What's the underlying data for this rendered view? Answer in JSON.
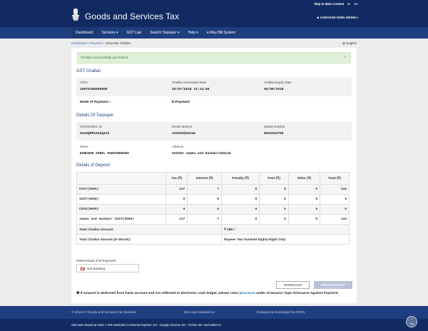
{
  "header": {
    "skip_link": "Skip to Main Content",
    "font_minus": "A-",
    "font_plus": "A+",
    "brand": "Goods and Services Tax",
    "user": "KANCHAN SUNIL MANSI"
  },
  "nav": [
    "Dashboard",
    "Services ▾",
    "GST Law",
    "Search Taxpayer ▾",
    "Help ▾",
    "e-Way Bill System"
  ],
  "breadcrumb": [
    "Dashboard",
    "Payment",
    "Generate Challan"
  ],
  "language": "English",
  "alert": "Challan successfully generated",
  "gst_challan": {
    "title": "GST Challan",
    "cpin_label": "CPIN",
    "cpin": "18070100000006",
    "gen_date_label": "Challan Generation Date",
    "gen_date": "20/07/2018 12:14:58",
    "exp_date_label": "Challan Expiry Date",
    "exp_date": "04/08/2018",
    "mode_label": "Mode of Payment :-",
    "mode": "E-Payment"
  },
  "taxpayer": {
    "title": "Details Of Taxpayer",
    "gstin_label": "GSTIN/Other Id",
    "gstin": "01AAQPM1032Q1CX",
    "email_label": "Email Address",
    "email": "vXXXXX@XXXom",
    "mobile_label": "Mobile Number",
    "mobile": "8XXXXX4750",
    "name_label": "Name",
    "name": "KANCHAN SUNIL MANSINGHANI",
    "address_label": "Address",
    "address": "XXXXXX Jammu and Kashmir184144"
  },
  "deposit": {
    "title": "Details of Deposit",
    "headers": [
      "",
      "Tax (₹)",
      "Interest (₹)",
      "Penalty (₹)",
      "Fees (₹)",
      "Other (₹)",
      "Total (₹)"
    ],
    "rows": [
      [
        "CGST(0005)",
        "137",
        "7",
        "0",
        "0",
        "0",
        "144"
      ],
      [
        "IGST(0008)",
        "0",
        "0",
        "0",
        "0",
        "0",
        "0"
      ],
      [
        "CESS(0009)",
        "0",
        "0",
        "0",
        "0",
        "0",
        "0"
      ],
      [
        "Jammu and Kashmir SGST(0006)",
        "137",
        "7",
        "0",
        "0",
        "0",
        "144"
      ]
    ],
    "total_label": "Total Challan Amount:",
    "total_value": "₹ 288 /-",
    "words_label": "Total Challan Amount (In Words):",
    "words_value": "Rupees Two hundred Eighty-Eight Only"
  },
  "payment_mode": {
    "label": "Select Mode of E-Payment",
    "required": "*",
    "selected": "Net Banking"
  },
  "buttons": {
    "download": "DOWNLOAD",
    "make_payment": "MAKE PAYMENT"
  },
  "note": {
    "part1": "If amount is deducted from bank account and not reflected in electronic cash ledger, please raise ",
    "link": "grievance",
    "part2": " under Grievance Type Grievance Against Payment."
  },
  "footer": {
    "copyright": "© 2016-17 Goods and Services Tax Network",
    "updated": "Site Last Updated on",
    "designed": "Designed & Developed by GSTN",
    "browser_note": "Site best viewed at 1024 x 768 resolution in Internet Explorer 10+, Google Chrome 49+, Firefox 45+ and Safari 6+",
    "top": "Top"
  }
}
